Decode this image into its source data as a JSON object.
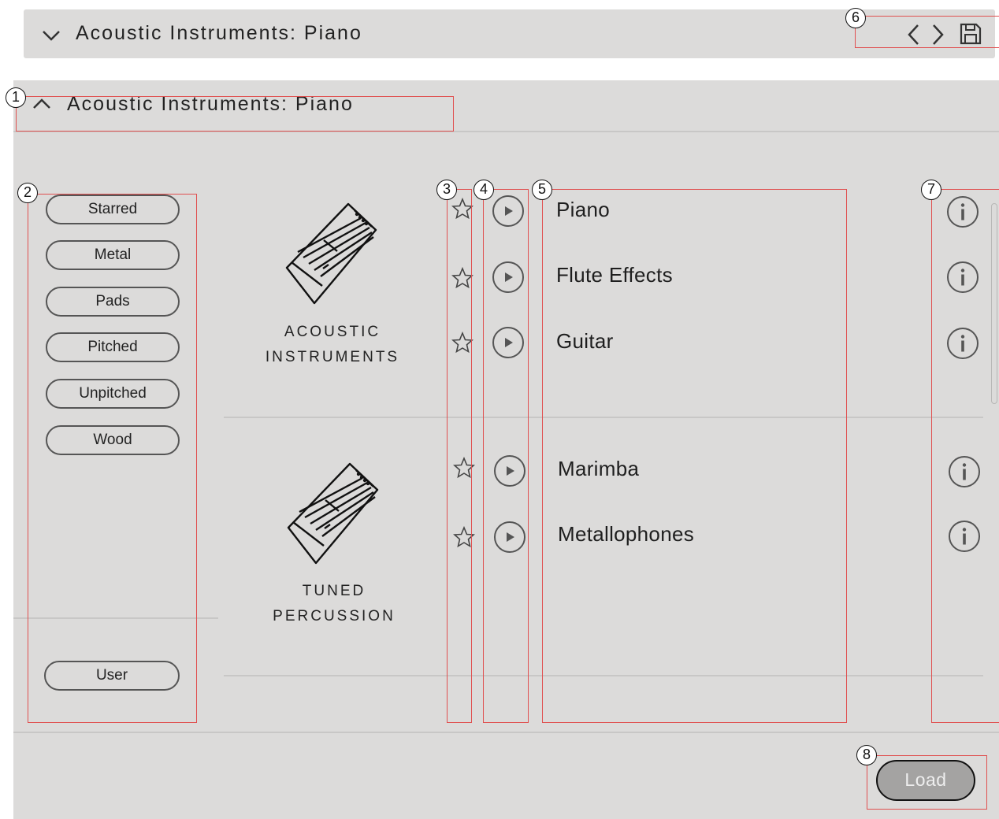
{
  "header": {
    "title": "Acoustic Instruments: Piano",
    "icons": [
      "chevron-down-icon",
      "chevron-left-icon",
      "chevron-right-icon",
      "save-icon"
    ]
  },
  "panel": {
    "title": "Acoustic Instruments: Piano",
    "collapse_icon": "chevron-up-icon"
  },
  "tags": {
    "items": [
      "Starred",
      "Metal",
      "Pads",
      "Pitched",
      "Unpitched",
      "Wood"
    ],
    "user": "User"
  },
  "categories": [
    {
      "label_line1": "ACOUSTIC",
      "label_line2": "INSTRUMENTS",
      "icon": "instrument-icon",
      "items": [
        "Piano",
        "Flute Effects",
        "Guitar"
      ]
    },
    {
      "label_line1": "TUNED",
      "label_line2": "PERCUSSION",
      "icon": "instrument-icon",
      "items": [
        "Marimba",
        "Metallophones"
      ]
    }
  ],
  "footer": {
    "load_label": "Load"
  },
  "callouts": [
    "1",
    "2",
    "3",
    "4",
    "5",
    "6",
    "7",
    "8"
  ],
  "colors": {
    "panel_bg": "#dcdbda",
    "annotation_red": "#e05050",
    "load_button_bg": "#a4a3a2"
  }
}
